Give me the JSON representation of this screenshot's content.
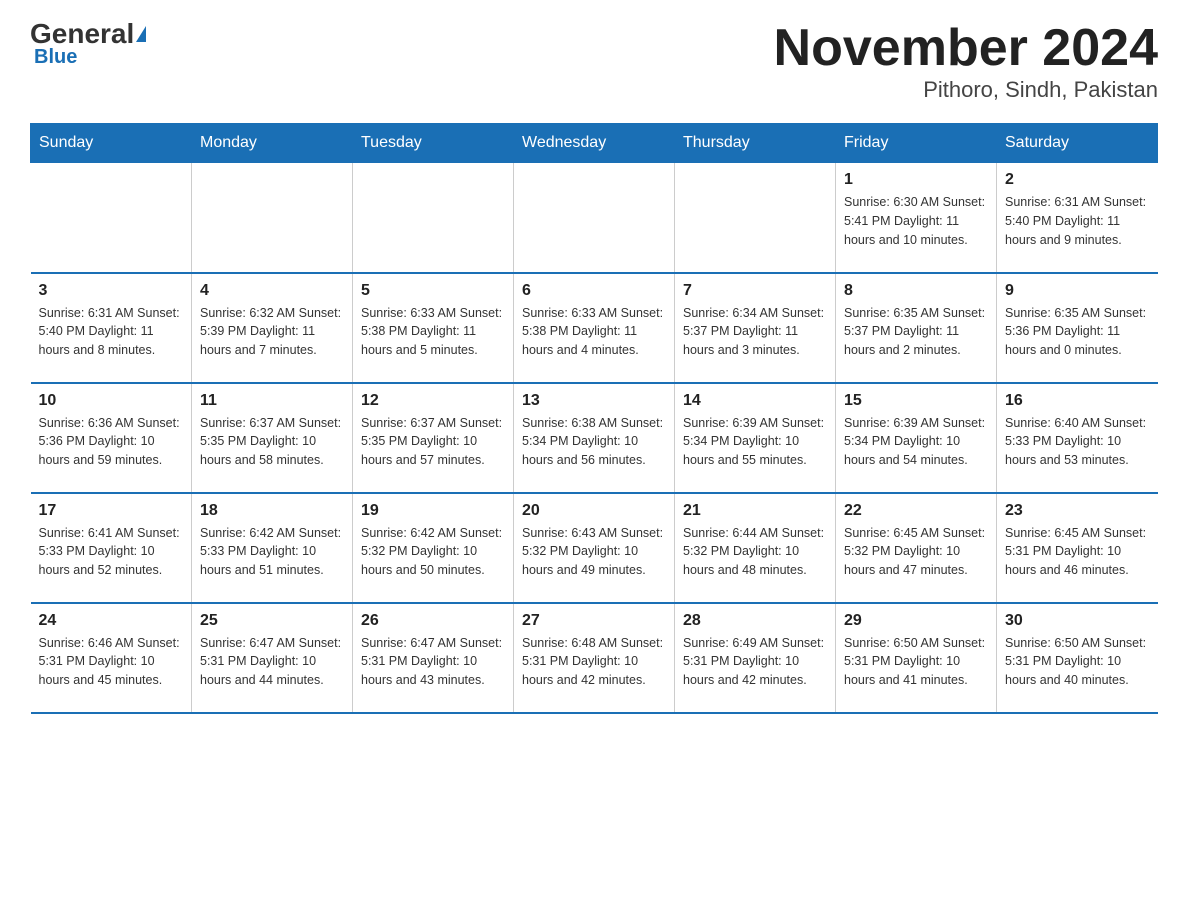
{
  "header": {
    "logo_general": "General",
    "logo_blue": "Blue",
    "title": "November 2024",
    "subtitle": "Pithoro, Sindh, Pakistan"
  },
  "days_of_week": [
    "Sunday",
    "Monday",
    "Tuesday",
    "Wednesday",
    "Thursday",
    "Friday",
    "Saturday"
  ],
  "weeks": [
    [
      {
        "day": "",
        "info": ""
      },
      {
        "day": "",
        "info": ""
      },
      {
        "day": "",
        "info": ""
      },
      {
        "day": "",
        "info": ""
      },
      {
        "day": "",
        "info": ""
      },
      {
        "day": "1",
        "info": "Sunrise: 6:30 AM\nSunset: 5:41 PM\nDaylight: 11 hours\nand 10 minutes."
      },
      {
        "day": "2",
        "info": "Sunrise: 6:31 AM\nSunset: 5:40 PM\nDaylight: 11 hours\nand 9 minutes."
      }
    ],
    [
      {
        "day": "3",
        "info": "Sunrise: 6:31 AM\nSunset: 5:40 PM\nDaylight: 11 hours\nand 8 minutes."
      },
      {
        "day": "4",
        "info": "Sunrise: 6:32 AM\nSunset: 5:39 PM\nDaylight: 11 hours\nand 7 minutes."
      },
      {
        "day": "5",
        "info": "Sunrise: 6:33 AM\nSunset: 5:38 PM\nDaylight: 11 hours\nand 5 minutes."
      },
      {
        "day": "6",
        "info": "Sunrise: 6:33 AM\nSunset: 5:38 PM\nDaylight: 11 hours\nand 4 minutes."
      },
      {
        "day": "7",
        "info": "Sunrise: 6:34 AM\nSunset: 5:37 PM\nDaylight: 11 hours\nand 3 minutes."
      },
      {
        "day": "8",
        "info": "Sunrise: 6:35 AM\nSunset: 5:37 PM\nDaylight: 11 hours\nand 2 minutes."
      },
      {
        "day": "9",
        "info": "Sunrise: 6:35 AM\nSunset: 5:36 PM\nDaylight: 11 hours\nand 0 minutes."
      }
    ],
    [
      {
        "day": "10",
        "info": "Sunrise: 6:36 AM\nSunset: 5:36 PM\nDaylight: 10 hours\nand 59 minutes."
      },
      {
        "day": "11",
        "info": "Sunrise: 6:37 AM\nSunset: 5:35 PM\nDaylight: 10 hours\nand 58 minutes."
      },
      {
        "day": "12",
        "info": "Sunrise: 6:37 AM\nSunset: 5:35 PM\nDaylight: 10 hours\nand 57 minutes."
      },
      {
        "day": "13",
        "info": "Sunrise: 6:38 AM\nSunset: 5:34 PM\nDaylight: 10 hours\nand 56 minutes."
      },
      {
        "day": "14",
        "info": "Sunrise: 6:39 AM\nSunset: 5:34 PM\nDaylight: 10 hours\nand 55 minutes."
      },
      {
        "day": "15",
        "info": "Sunrise: 6:39 AM\nSunset: 5:34 PM\nDaylight: 10 hours\nand 54 minutes."
      },
      {
        "day": "16",
        "info": "Sunrise: 6:40 AM\nSunset: 5:33 PM\nDaylight: 10 hours\nand 53 minutes."
      }
    ],
    [
      {
        "day": "17",
        "info": "Sunrise: 6:41 AM\nSunset: 5:33 PM\nDaylight: 10 hours\nand 52 minutes."
      },
      {
        "day": "18",
        "info": "Sunrise: 6:42 AM\nSunset: 5:33 PM\nDaylight: 10 hours\nand 51 minutes."
      },
      {
        "day": "19",
        "info": "Sunrise: 6:42 AM\nSunset: 5:32 PM\nDaylight: 10 hours\nand 50 minutes."
      },
      {
        "day": "20",
        "info": "Sunrise: 6:43 AM\nSunset: 5:32 PM\nDaylight: 10 hours\nand 49 minutes."
      },
      {
        "day": "21",
        "info": "Sunrise: 6:44 AM\nSunset: 5:32 PM\nDaylight: 10 hours\nand 48 minutes."
      },
      {
        "day": "22",
        "info": "Sunrise: 6:45 AM\nSunset: 5:32 PM\nDaylight: 10 hours\nand 47 minutes."
      },
      {
        "day": "23",
        "info": "Sunrise: 6:45 AM\nSunset: 5:31 PM\nDaylight: 10 hours\nand 46 minutes."
      }
    ],
    [
      {
        "day": "24",
        "info": "Sunrise: 6:46 AM\nSunset: 5:31 PM\nDaylight: 10 hours\nand 45 minutes."
      },
      {
        "day": "25",
        "info": "Sunrise: 6:47 AM\nSunset: 5:31 PM\nDaylight: 10 hours\nand 44 minutes."
      },
      {
        "day": "26",
        "info": "Sunrise: 6:47 AM\nSunset: 5:31 PM\nDaylight: 10 hours\nand 43 minutes."
      },
      {
        "day": "27",
        "info": "Sunrise: 6:48 AM\nSunset: 5:31 PM\nDaylight: 10 hours\nand 42 minutes."
      },
      {
        "day": "28",
        "info": "Sunrise: 6:49 AM\nSunset: 5:31 PM\nDaylight: 10 hours\nand 42 minutes."
      },
      {
        "day": "29",
        "info": "Sunrise: 6:50 AM\nSunset: 5:31 PM\nDaylight: 10 hours\nand 41 minutes."
      },
      {
        "day": "30",
        "info": "Sunrise: 6:50 AM\nSunset: 5:31 PM\nDaylight: 10 hours\nand 40 minutes."
      }
    ]
  ]
}
